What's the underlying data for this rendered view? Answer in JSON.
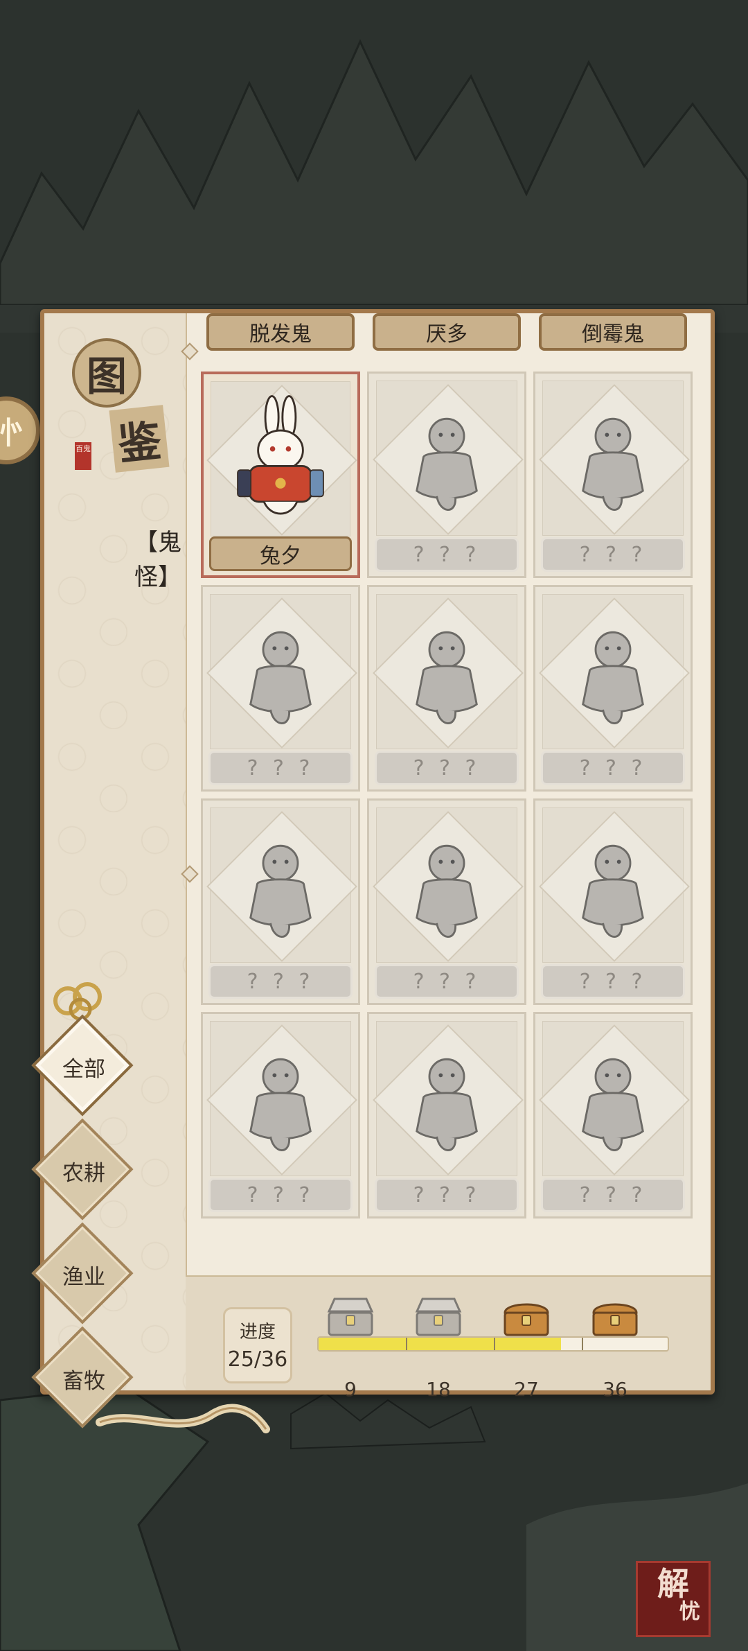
{
  "panel": {
    "logo_char_1": "图",
    "logo_char_2": "鉴",
    "logo_seal": "百鬼",
    "category_label": "【鬼怪】"
  },
  "categories": [
    {
      "label": "全部",
      "active": true
    },
    {
      "label": "农耕",
      "active": false
    },
    {
      "label": "渔业",
      "active": false
    },
    {
      "label": "畜牧",
      "active": false
    }
  ],
  "header_row": [
    "脱发鬼",
    "厌多",
    "倒霉鬼"
  ],
  "grid": [
    {
      "name": "兔夕",
      "unlocked": true,
      "icon": "rabbit-ghost-icon"
    },
    {
      "name": "? ? ?",
      "unlocked": false,
      "icon": "snail-ghost-icon"
    },
    {
      "name": "? ? ?",
      "unlocked": false,
      "icon": "lantern-ghost-icon"
    },
    {
      "name": "? ? ?",
      "unlocked": false,
      "icon": "firework-ghost-icon"
    },
    {
      "name": "? ? ?",
      "unlocked": false,
      "icon": "flame-ghost-icon"
    },
    {
      "name": "? ? ?",
      "unlocked": false,
      "icon": "ox-ghost-icon"
    },
    {
      "name": "? ? ?",
      "unlocked": false,
      "icon": "umbrella-ghost-icon"
    },
    {
      "name": "? ? ?",
      "unlocked": false,
      "icon": "dragon-boat-ghost-icon"
    },
    {
      "name": "? ? ?",
      "unlocked": false,
      "icon": "farmer-ghost-icon"
    },
    {
      "name": "? ? ?",
      "unlocked": false,
      "icon": "scholar-ghost-icon"
    },
    {
      "name": "? ? ?",
      "unlocked": false,
      "icon": "dragon-rider-ghost-icon"
    },
    {
      "name": "? ? ?",
      "unlocked": false,
      "icon": "fortune-ghost-icon"
    }
  ],
  "progress": {
    "label": "进度",
    "value_text": "25/36",
    "current": 25,
    "total": 36,
    "milestones": [
      {
        "value": "9",
        "icon": "chest-opened-icon"
      },
      {
        "value": "18",
        "icon": "chest-opened-icon"
      },
      {
        "value": "27",
        "icon": "chest-closed-icon"
      },
      {
        "value": "36",
        "icon": "chest-closed-icon"
      }
    ]
  },
  "stamp": {
    "char_1": "解",
    "char_2": "忧"
  },
  "edge_button": {
    "label": "㣺"
  },
  "colors": {
    "panel_bg": "#f2ebdd",
    "panel_border": "#a3794c",
    "progress_fill": "#efe04a",
    "unlocked_border": "#b86b5a",
    "stamp_red": "#6e1d1a"
  }
}
